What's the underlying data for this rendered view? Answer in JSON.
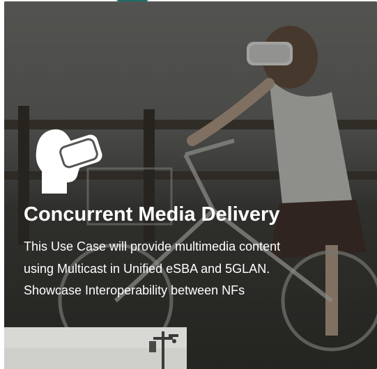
{
  "card": {
    "title": "Concurrent Media Delivery",
    "description": "This Use Case will provide multimedia content using Multicast in Unified eSBA and 5GLAN. Showcase Interoperability between NFs",
    "icon": "vr-headset-icon"
  },
  "colors": {
    "overlay_text": "#ffffff",
    "top_accent": "#1f6f6a"
  }
}
